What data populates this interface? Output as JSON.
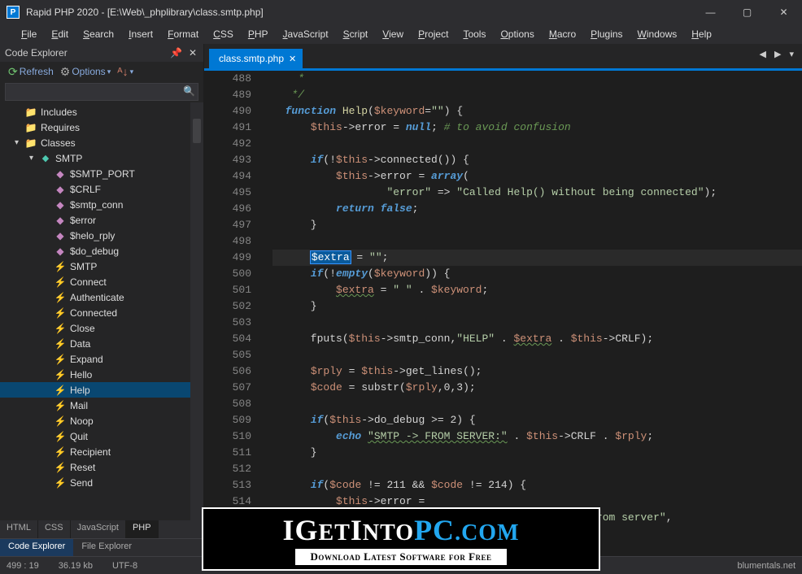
{
  "window": {
    "app_icon": "P",
    "title": "Rapid PHP 2020 - [E:\\Web\\_phplibrary\\class.smtp.php]",
    "controls": {
      "min": "—",
      "max": "▢",
      "close": "✕"
    }
  },
  "menu": [
    "File",
    "Edit",
    "Search",
    "Insert",
    "Format",
    "CSS",
    "PHP",
    "JavaScript",
    "Script",
    "View",
    "Project",
    "Tools",
    "Options",
    "Macro",
    "Plugins",
    "Windows",
    "Help"
  ],
  "sidepanel": {
    "header": "Code Explorer",
    "refresh": "Refresh",
    "options": "Options",
    "search_placeholder": "",
    "tree": [
      {
        "type": "folder",
        "label": "Includes",
        "indent": 1
      },
      {
        "type": "folder",
        "label": "Requires",
        "indent": 1
      },
      {
        "type": "folder",
        "label": "Classes",
        "indent": 1,
        "open": true
      },
      {
        "type": "class",
        "label": "SMTP",
        "indent": 2,
        "open": true
      },
      {
        "type": "prop",
        "label": "$SMTP_PORT",
        "indent": 3
      },
      {
        "type": "prop",
        "label": "$CRLF",
        "indent": 3
      },
      {
        "type": "prop",
        "label": "$smtp_conn",
        "indent": 3
      },
      {
        "type": "prop",
        "label": "$error",
        "indent": 3
      },
      {
        "type": "prop",
        "label": "$helo_rply",
        "indent": 3
      },
      {
        "type": "prop",
        "label": "$do_debug",
        "indent": 3
      },
      {
        "type": "method",
        "label": "SMTP",
        "indent": 3
      },
      {
        "type": "method",
        "label": "Connect",
        "indent": 3
      },
      {
        "type": "method",
        "label": "Authenticate",
        "indent": 3
      },
      {
        "type": "method",
        "label": "Connected",
        "indent": 3
      },
      {
        "type": "method",
        "label": "Close",
        "indent": 3
      },
      {
        "type": "method",
        "label": "Data",
        "indent": 3
      },
      {
        "type": "method",
        "label": "Expand",
        "indent": 3
      },
      {
        "type": "method",
        "label": "Hello",
        "indent": 3
      },
      {
        "type": "method",
        "label": "Help",
        "indent": 3,
        "selected": true
      },
      {
        "type": "method",
        "label": "Mail",
        "indent": 3
      },
      {
        "type": "method",
        "label": "Noop",
        "indent": 3
      },
      {
        "type": "method",
        "label": "Quit",
        "indent": 3
      },
      {
        "type": "method",
        "label": "Recipient",
        "indent": 3
      },
      {
        "type": "method",
        "label": "Reset",
        "indent": 3
      },
      {
        "type": "method",
        "label": "Send",
        "indent": 3
      }
    ],
    "lang_tabs": [
      "HTML",
      "CSS",
      "JavaScript",
      "PHP"
    ],
    "lang_active": "PHP",
    "explorer_tabs": [
      "Code Explorer",
      "File Explorer"
    ],
    "explorer_active": "Code Explorer"
  },
  "editor": {
    "active_tab": "class.smtp.php",
    "first_line": 488,
    "code_lines": [
      {
        "raw": "    *"
      },
      {
        "raw": "   */"
      },
      {
        "html": "  <span class='kf'>function</span> <span class='fn2'>Help</span>(<span class='var'>$keyword</span>=<span class='str-green'>\"\"</span>) {"
      },
      {
        "html": "      <span class='var'>$this</span>-&gt;error = <span class='kf'>null</span>; <span class='c'># to avoid confusion</span>"
      },
      {
        "raw": ""
      },
      {
        "html": "      <span class='kf'>if</span>(!<span class='var'>$this</span>-&gt;connected()) {"
      },
      {
        "html": "          <span class='var'>$this</span>-&gt;error = <span class='kf'>array</span>("
      },
      {
        "html": "                  <span class='str-green'>\"error\"</span> =&gt; <span class='str-green'>\"Called Help() without being connected\"</span>);"
      },
      {
        "html": "          <span class='kf'>return</span> <span class='kf'>false</span>;"
      },
      {
        "html": "      }"
      },
      {
        "raw": ""
      },
      {
        "html": "      <span class='sel'>$extra</span> = <span class='str-green'>\"\"</span>;",
        "hl": true
      },
      {
        "html": "      <span class='kf'>if</span>(!<span class='kf'>empty</span>(<span class='var'>$keyword</span>)) {"
      },
      {
        "html": "          <span class='var ul-wavy'>$extra</span> = <span class='str-green'>\" \"</span> . <span class='var'>$keyword</span>;"
      },
      {
        "html": "      }"
      },
      {
        "raw": ""
      },
      {
        "html": "      fputs(<span class='var'>$this</span>-&gt;smtp_conn,<span class='str-green'>\"HELP\"</span> . <span class='var ul-wavy'>$extra</span> . <span class='var'>$this</span>-&gt;CRLF);"
      },
      {
        "raw": ""
      },
      {
        "html": "      <span class='var'>$rply</span> = <span class='var'>$this</span>-&gt;get_lines();"
      },
      {
        "html": "      <span class='var'>$code</span> = substr(<span class='var'>$rply</span>,0,3);"
      },
      {
        "raw": ""
      },
      {
        "html": "      <span class='kf'>if</span>(<span class='var'>$this</span>-&gt;do_debug &gt;= 2) {"
      },
      {
        "html": "          <span class='kf'>echo</span> <span class='str-green ul-wavy'>\"SMTP -&gt; FROM SERVER:\"</span> . <span class='var'>$this</span>-&gt;CRLF . <span class='var'>$rply</span>;"
      },
      {
        "html": "      }"
      },
      {
        "raw": ""
      },
      {
        "html": "      <span class='kf'>if</span>(<span class='var'>$code</span> != 211 &amp;&amp; <span class='var'>$code</span> != 214) {"
      },
      {
        "html": "          <span class='var'>$this</span>-&gt;error ="
      },
      {
        "html": "              <span class='kf'>array</span>(<span class='str-green'>\"error\"</span> =&gt; <span class='str-green'>\"HELP not accepted from server\"</span>,"
      }
    ]
  },
  "statusbar": {
    "position": "499 : 19",
    "filesize": "36.19 kb",
    "encoding": "UTF-8",
    "brand": "blumentals.net"
  },
  "watermark": {
    "main_before": "IG",
    "main_mid": "ET",
    "main_mid2": "I",
    "main_nto": "NTO",
    "main_pc": "PC",
    "main_com": ".COM",
    "sub": "Download Latest Software for Free"
  }
}
